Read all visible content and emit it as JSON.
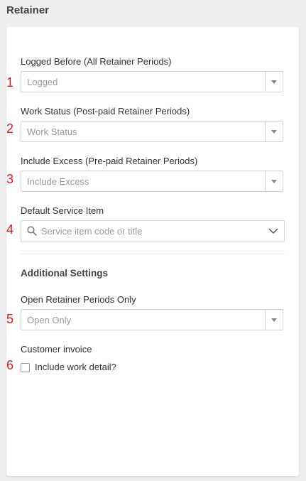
{
  "page": {
    "title": "Retainer"
  },
  "markers": [
    "1",
    "2",
    "3",
    "4",
    "5",
    "6"
  ],
  "fields": {
    "logged_before": {
      "label": "Logged Before (All Retainer Periods)",
      "value": "Logged"
    },
    "work_status": {
      "label": "Work Status (Post-paid Retainer Periods)",
      "value": "Work Status"
    },
    "include_excess": {
      "label": "Include Excess (Pre-paid Retainer Periods)",
      "value": "Include Excess"
    },
    "default_service_item": {
      "label": "Default Service Item",
      "placeholder": "Service item code or title"
    }
  },
  "additional_settings": {
    "heading": "Additional Settings",
    "open_periods": {
      "label": "Open Retainer Periods Only",
      "value": "Open Only"
    },
    "customer_invoice": {
      "label": "Customer invoice",
      "checkbox_label": "Include work detail?",
      "checked": false
    }
  },
  "colors": {
    "marker": "#e0191b",
    "background": "#eeeeee",
    "panel": "#ffffff",
    "placeholder": "#9a9a9a"
  },
  "icons": [
    "caret-down-icon",
    "search-icon",
    "chevron-down-icon"
  ]
}
